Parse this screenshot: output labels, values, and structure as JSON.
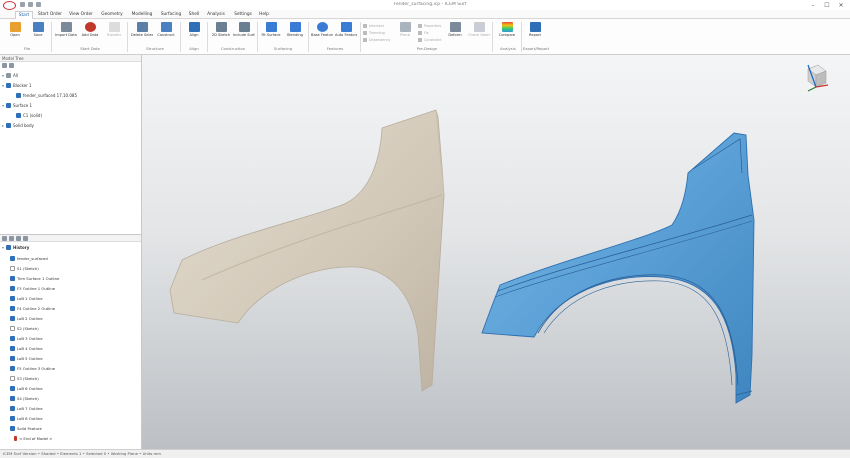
{
  "window": {
    "title": "Fender_surfacing.icp - ICEM Surf",
    "controls": [
      "–",
      "☐",
      "✕"
    ]
  },
  "menu": {
    "tabs": [
      "Start",
      "Start Order",
      "View Order",
      "Geometry",
      "Modelling",
      "Surfacing",
      "Shell",
      "Analysis",
      "Settings",
      "Help"
    ],
    "active": "Start"
  },
  "ribbon": {
    "buttons": [
      {
        "label": "Open",
        "icon": "folder-open-icon",
        "color": "#e8a030"
      },
      {
        "label": "Save",
        "icon": "save-icon",
        "color": "#4a7fc1"
      },
      {
        "label": "Import Data",
        "icon": "import-icon",
        "color": "#7a8a9a"
      },
      {
        "label": "Add Data",
        "icon": "add-data-icon",
        "color": "#c0392b"
      },
      {
        "label": "Transfer",
        "icon": "transfer-icon",
        "color": "#c8c8c8",
        "dim": true
      },
      {
        "label": "Delete Selection",
        "icon": "delete-selection-icon",
        "color": "#5b7fa6"
      },
      {
        "label": "Construct",
        "icon": "construct-icon",
        "color": "#4a7fc1"
      },
      {
        "label": "Align",
        "icon": "align-icon",
        "color": "#2f6fb8"
      },
      {
        "label": "2D Sketch",
        "icon": "sketch-icon",
        "color": "#6a7f92"
      },
      {
        "label": "Include Surfaces",
        "icon": "include-surfaces-icon",
        "color": "#6a7f92"
      },
      {
        "label": "Fit Surface",
        "icon": "fit-surface-icon",
        "color": "#3a7bd5"
      },
      {
        "label": "Blending",
        "icon": "blending-icon",
        "color": "#3a7bd5"
      },
      {
        "label": "Base Features",
        "icon": "base-features-icon",
        "color": "#3a7bd5"
      },
      {
        "label": "Auto Features",
        "icon": "auto-features-icon",
        "color": "#3a7bd5"
      },
      {
        "label": "Plane",
        "icon": "plane-icon",
        "color": "#aab4be"
      },
      {
        "label": "Deform",
        "icon": "deform-icon",
        "color": "#7a8a9a"
      },
      {
        "label": "Check Geometry",
        "icon": "check-geometry-icon",
        "color": "#aab4be",
        "dim": true
      },
      {
        "label": "Compare",
        "icon": "compare-icon",
        "color": "#3cb371"
      },
      {
        "label": "Report",
        "icon": "report-icon",
        "color": "#2f6fb8"
      }
    ],
    "small_tools_a": [
      "Intersect",
      "Trimming",
      "Dependency"
    ],
    "small_tools_b": [
      "Properties",
      "Fix",
      "Constraint"
    ],
    "groups": [
      "File",
      "Start Data",
      "Structure",
      "Align",
      "Construction",
      "Surfacing",
      "Features",
      "Pre-Design",
      "Analysis",
      "Export/Report"
    ]
  },
  "tree_panel": {
    "header": "Model Tree",
    "items": [
      {
        "label": "All",
        "level": 0,
        "color": "#8b96a3"
      },
      {
        "label": "Blocker 1",
        "level": 0,
        "color": "#2f6fb8"
      },
      {
        "label": "fender_surfaced 17.10.085",
        "level": 1,
        "color": "#2f6fb8"
      },
      {
        "label": "Surface 1",
        "level": 0,
        "color": "#2f6fb8"
      },
      {
        "label": "C1 (solid)",
        "level": 1,
        "color": "#2f6fb8"
      },
      {
        "label": "Solid body",
        "level": 0,
        "color": "#2f6fb8"
      }
    ]
  },
  "history_panel": {
    "root": "History",
    "items": [
      {
        "label": "fender_surfaced",
        "color": "#2f6fb8"
      },
      {
        "label": "S1 (Sketch)",
        "color": "#ffffff"
      },
      {
        "label": "Trim Surface 1 Outline",
        "color": "#2f6fb8"
      },
      {
        "label": "F3 Outline 1 Outline",
        "color": "#2f6fb8"
      },
      {
        "label": "LoB 1 Outline",
        "color": "#2f6fb8"
      },
      {
        "label": "F4 Outline 2 Outline",
        "color": "#2f6fb8"
      },
      {
        "label": "LoB 2 Outline",
        "color": "#2f6fb8"
      },
      {
        "label": "S2 (Sketch)",
        "color": "#ffffff"
      },
      {
        "label": "LoB 3 Outline",
        "color": "#2f6fb8"
      },
      {
        "label": "LoB 4 Outline",
        "color": "#2f6fb8"
      },
      {
        "label": "LoB 5 Outline",
        "color": "#2f6fb8"
      },
      {
        "label": "F5 Outline 3 Outline",
        "color": "#2f6fb8"
      },
      {
        "label": "S3 (Sketch)",
        "color": "#ffffff"
      },
      {
        "label": "LoB 6 Outline",
        "color": "#2f6fb8"
      },
      {
        "label": "S4 (Sketch)",
        "color": "#2f6fb8"
      },
      {
        "label": "LoB 7 Outline",
        "color": "#2f6fb8"
      },
      {
        "label": "LoB 8 Outline",
        "color": "#2f6fb8"
      },
      {
        "label": "Solid Feature",
        "color": "#2f6fb8"
      },
      {
        "label": "< End of Model >",
        "color": "#c0392b"
      }
    ]
  },
  "viewport": {
    "raw_part_color": "#d7cebf",
    "surfaced_part_color": "#5aa0d6",
    "axis_colors": {
      "x": "#d32f2f",
      "y": "#2e7d32",
      "z": "#1565c0"
    }
  },
  "status": {
    "text": "ICEM Surf Version • Shaded • Elements 1 • Selected 0 • Working Plane • Units mm"
  }
}
